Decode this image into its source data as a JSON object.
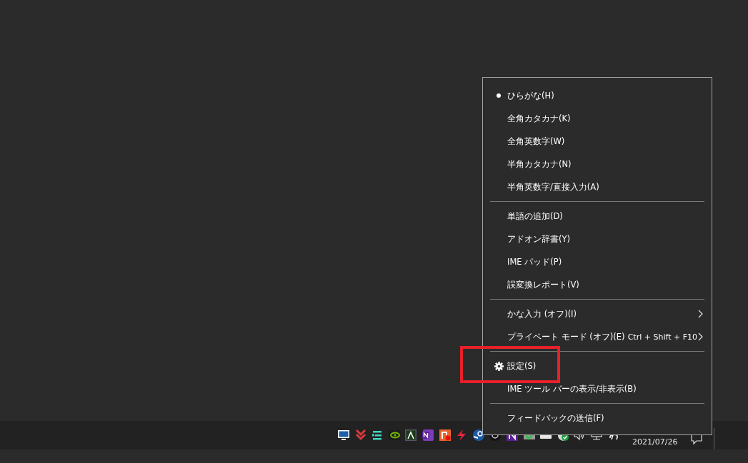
{
  "menu": {
    "sections": [
      [
        {
          "kind": "radio",
          "label": "ひらがな(H)",
          "selected": true
        },
        {
          "kind": "radio",
          "label": "全角カタカナ(K)",
          "selected": false
        },
        {
          "kind": "radio",
          "label": "全角英数字(W)",
          "selected": false
        },
        {
          "kind": "radio",
          "label": "半角カタカナ(N)",
          "selected": false
        },
        {
          "kind": "radio",
          "label": "半角英数字/直接入力(A)",
          "selected": false
        }
      ],
      [
        {
          "kind": "plain",
          "label": "単語の追加(D)"
        },
        {
          "kind": "plain",
          "label": "アドオン辞書(Y)"
        },
        {
          "kind": "plain",
          "label": "IME パッド(P)"
        },
        {
          "kind": "plain",
          "label": "誤変換レポート(V)"
        }
      ],
      [
        {
          "kind": "submenu",
          "label": "かな入力 (オフ)(I)"
        },
        {
          "kind": "submenu",
          "label": "プライベート モード (オフ)(E)",
          "shortcut": "Ctrl + Shift + F10"
        }
      ],
      [
        {
          "kind": "settings",
          "label": "設定(S)",
          "highlighted": true
        },
        {
          "kind": "plain",
          "label": "IME ツール バーの表示/非表示(B)"
        }
      ],
      [
        {
          "kind": "plain",
          "label": "フィードバックの送信(F)"
        }
      ]
    ]
  },
  "taskbar": {
    "date": "2021/07/26"
  }
}
